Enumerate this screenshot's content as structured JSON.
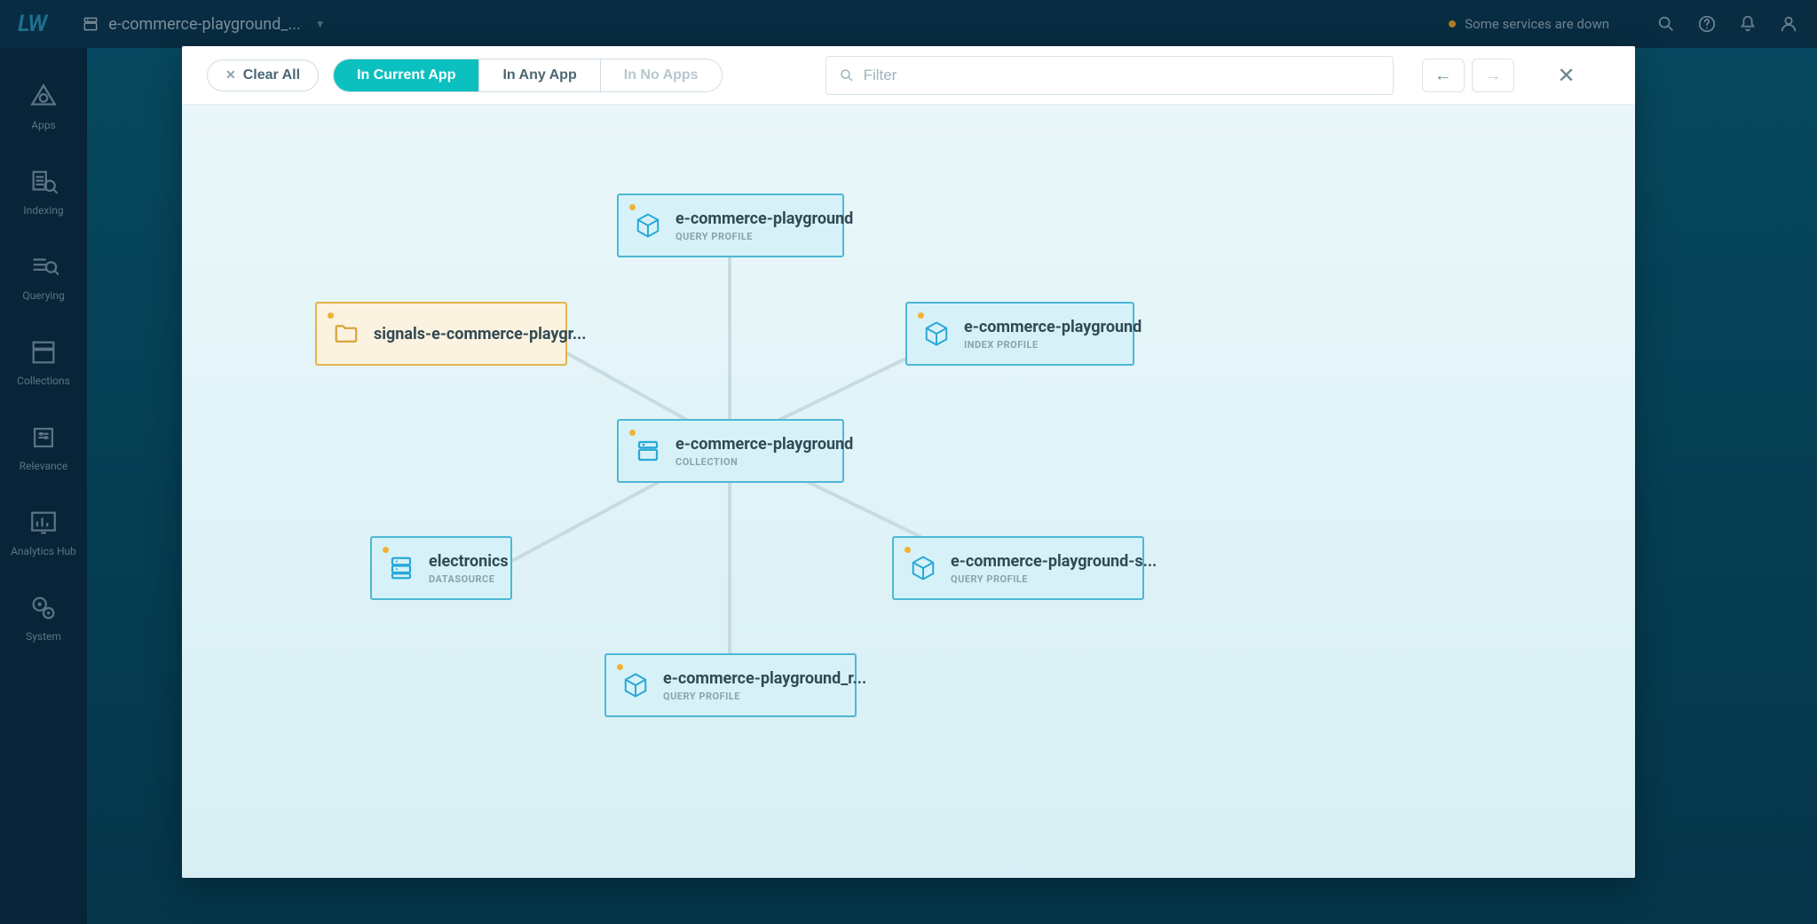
{
  "header": {
    "logo": "LW",
    "app_name": "e-commerce-playground_...",
    "status_text": "Some services are down"
  },
  "sidebar": {
    "items": [
      {
        "label": "Apps",
        "icon": "apps"
      },
      {
        "label": "Indexing",
        "icon": "indexing"
      },
      {
        "label": "Querying",
        "icon": "querying"
      },
      {
        "label": "Collections",
        "icon": "collections"
      },
      {
        "label": "Relevance",
        "icon": "relevance"
      },
      {
        "label": "Analytics Hub",
        "icon": "analytics"
      },
      {
        "label": "System",
        "icon": "system"
      }
    ]
  },
  "modal": {
    "clear_label": "Clear All",
    "scope": {
      "current": "In Current App",
      "any": "In Any App",
      "none": "In No Apps"
    },
    "filter_placeholder": "Filter"
  },
  "nodes": {
    "n1": {
      "title": "e-commerce-playground",
      "sub": "QUERY PROFILE",
      "icon": "cube"
    },
    "n2": {
      "title": "signals-e-commerce-playgr...",
      "sub": "",
      "icon": "folder"
    },
    "n3": {
      "title": "e-commerce-playground",
      "sub": "INDEX PROFILE",
      "icon": "cube"
    },
    "n4": {
      "title": "e-commerce-playground",
      "sub": "COLLECTION",
      "icon": "stack"
    },
    "n5": {
      "title": "electronics",
      "sub": "DATASOURCE",
      "icon": "server"
    },
    "n6": {
      "title": "e-commerce-playground-s...",
      "sub": "QUERY PROFILE",
      "icon": "cube"
    },
    "n7": {
      "title": "e-commerce-playground_r...",
      "sub": "QUERY PROFILE",
      "icon": "cube"
    }
  }
}
